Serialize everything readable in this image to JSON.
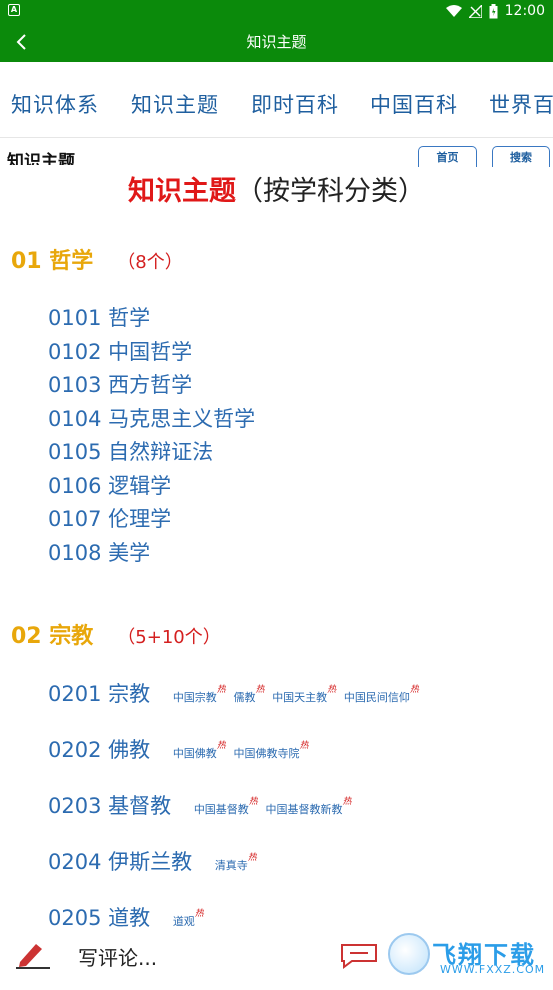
{
  "status_bar": {
    "left_badge": "A",
    "time": "12:00"
  },
  "app_bar": {
    "title": "知识主题"
  },
  "tabs": [
    "知识体系",
    "知识主题",
    "即时百科",
    "中国百科",
    "世界百科"
  ],
  "page_header": {
    "title": "知识主题",
    "home_button": "首页",
    "search_button": "搜索"
  },
  "heading": {
    "main": "知识主题",
    "suffix": "（按学科分类）"
  },
  "sections": [
    {
      "label": "01 哲学",
      "count": "（8个）",
      "items": [
        {
          "label": "0101 哲学",
          "subs": []
        },
        {
          "label": "0102 中国哲学",
          "subs": []
        },
        {
          "label": "0103 西方哲学",
          "subs": []
        },
        {
          "label": "0104 马克思主义哲学",
          "subs": []
        },
        {
          "label": "0105 自然辩证法",
          "subs": []
        },
        {
          "label": "0106 逻辑学",
          "subs": []
        },
        {
          "label": "0107 伦理学",
          "subs": []
        },
        {
          "label": "0108 美学",
          "subs": []
        }
      ]
    },
    {
      "label": "02 宗教",
      "count": "（5+10个）",
      "items": [
        {
          "label": "0201 宗教",
          "subs": [
            "中国宗教",
            "儒教",
            "中国天主教",
            "中国民间信仰"
          ]
        },
        {
          "label": "0202 佛教",
          "subs": [
            "中国佛教",
            "中国佛教寺院"
          ]
        },
        {
          "label": "0203 基督教",
          "subs": [
            "中国基督教",
            "中国基督教新教"
          ]
        },
        {
          "label": "0204 伊斯兰教",
          "subs": [
            "清真寺"
          ]
        },
        {
          "label": "0205 道教",
          "subs": [
            "道观"
          ]
        }
      ]
    }
  ],
  "hot_mark": "热",
  "bottom_bar": {
    "comment_placeholder": "写评论..."
  },
  "watermark": {
    "text": "飞翔下载",
    "url_text": "WWW.FXXZ.COM"
  },
  "colors": {
    "app_green": "#0b8a0b",
    "link_blue": "#2c6bb0",
    "section_orange": "#e8a70b",
    "accent_red": "#e01818"
  }
}
